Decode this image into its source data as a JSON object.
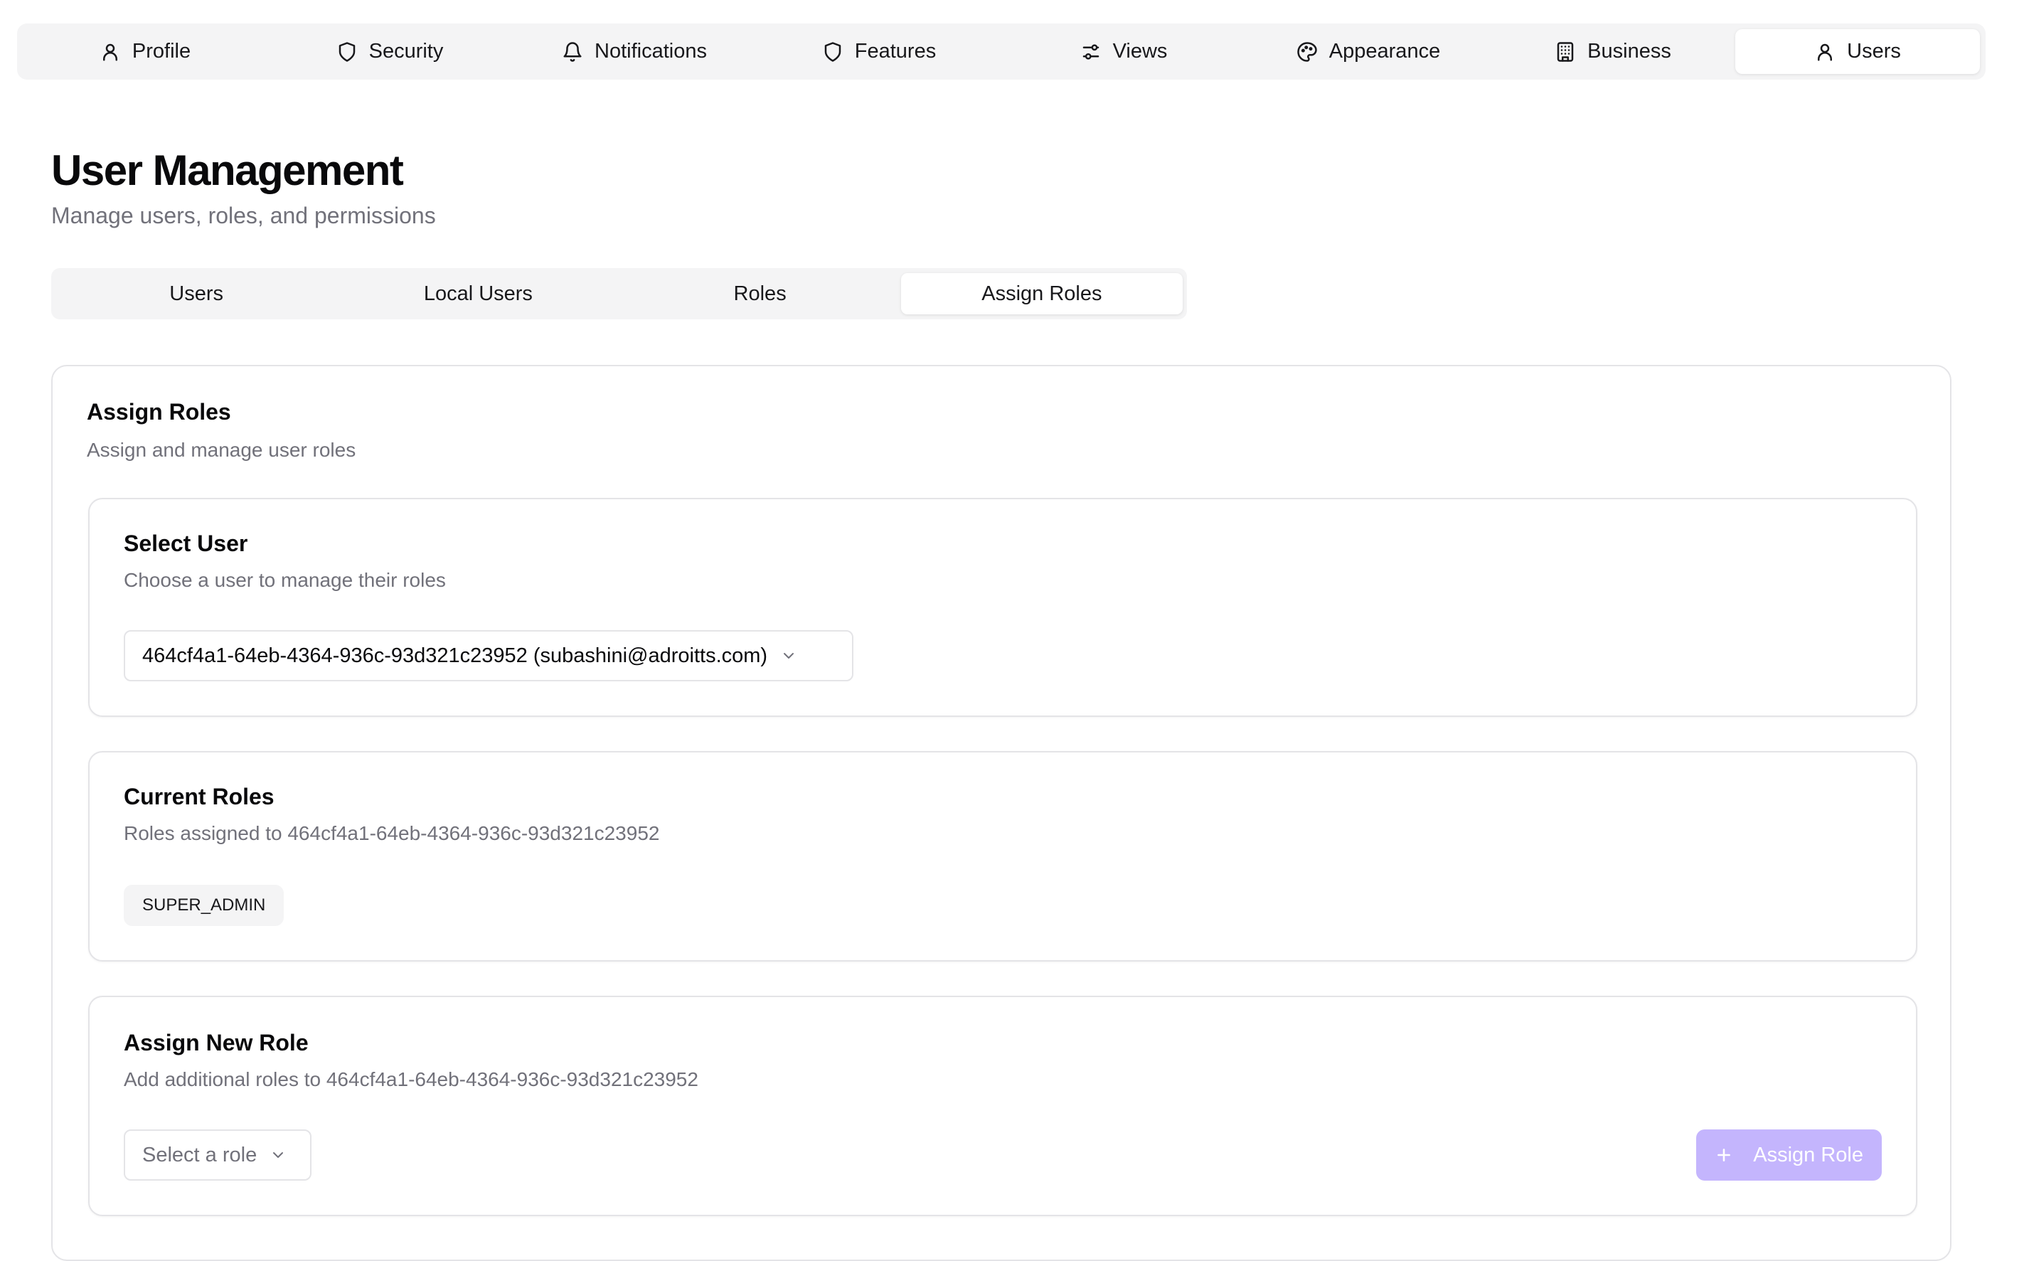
{
  "top_nav": {
    "items": [
      {
        "label": "Profile",
        "icon": "user-icon"
      },
      {
        "label": "Security",
        "icon": "shield-icon"
      },
      {
        "label": "Notifications",
        "icon": "bell-icon"
      },
      {
        "label": "Features",
        "icon": "shield-icon"
      },
      {
        "label": "Views",
        "icon": "sliders-icon"
      },
      {
        "label": "Appearance",
        "icon": "palette-icon"
      },
      {
        "label": "Business",
        "icon": "building-icon"
      },
      {
        "label": "Users",
        "icon": "user-icon",
        "active": true
      }
    ]
  },
  "page": {
    "title": "User Management",
    "subtitle": "Manage users, roles, and permissions"
  },
  "sub_tabs": {
    "items": [
      {
        "label": "Users"
      },
      {
        "label": "Local Users"
      },
      {
        "label": "Roles"
      },
      {
        "label": "Assign Roles",
        "active": true
      }
    ]
  },
  "assign_roles": {
    "title": "Assign Roles",
    "description": "Assign and manage user roles",
    "select_user": {
      "title": "Select User",
      "description": "Choose a user to manage their roles",
      "selected_value": "464cf4a1-64eb-4364-936c-93d321c23952 (subashini@adroitts.com)"
    },
    "current_roles": {
      "title": "Current Roles",
      "description": "Roles assigned to 464cf4a1-64eb-4364-936c-93d321c23952",
      "roles": [
        "SUPER_ADMIN"
      ]
    },
    "assign_new_role": {
      "title": "Assign New Role",
      "description": "Add additional roles to 464cf4a1-64eb-4364-936c-93d321c23952",
      "select_placeholder": "Select a role",
      "button_label": "Assign Role"
    }
  },
  "colors": {
    "accent_disabled": "#c4b5fd",
    "muted_text": "#71717a",
    "border": "#e4e4e7",
    "tab_bg": "#f4f4f5"
  }
}
